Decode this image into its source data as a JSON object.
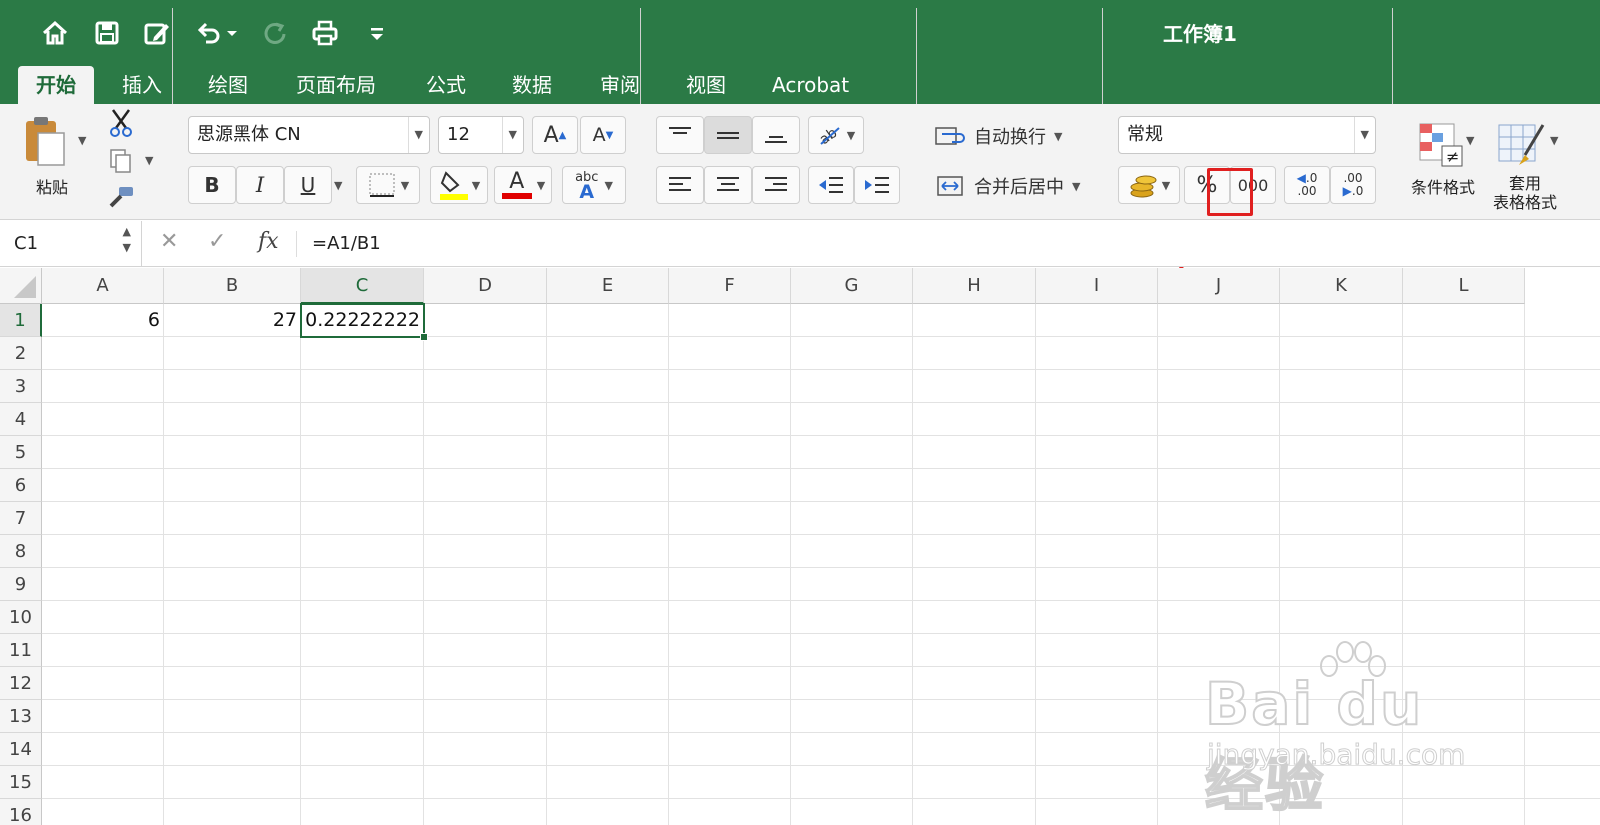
{
  "window": {
    "title": "工作簿1"
  },
  "quick_access": [
    {
      "icon": "home-icon"
    },
    {
      "icon": "save-icon"
    },
    {
      "icon": "edit-document-icon"
    },
    {
      "icon": "undo-icon"
    },
    {
      "icon": "redo-icon"
    },
    {
      "icon": "print-icon"
    },
    {
      "icon": "customize-icon"
    }
  ],
  "tabs": [
    "开始",
    "插入",
    "绘图",
    "页面布局",
    "公式",
    "数据",
    "审阅",
    "视图",
    "Acrobat"
  ],
  "ribbon": {
    "paste_label": "粘贴",
    "font_name": "思源黑体 CN",
    "font_size": "12",
    "bold": "B",
    "italic": "I",
    "underline": "U",
    "font_color_glyph": "A",
    "phonetic_glyph_top": "abc",
    "phonetic_glyph_bottom": "A",
    "grow_font": "A",
    "shrink_font": "A",
    "wrap_text_label": "自动换行",
    "merge_center_label": "合并后居中",
    "number_format": "常规",
    "percent_label": "%",
    "comma_label": "000",
    "increase_decimal_top": ".0",
    "increase_decimal_bottom": ".00",
    "decrease_decimal_top": ".00",
    "decrease_decimal_bottom": ".0",
    "conditional_format_label": "条件格式",
    "table_format_label_1": "套用",
    "table_format_label_2": "表格格式",
    "colors": {
      "highlight": "#ffff00",
      "font": "#e00000",
      "brand": "#2b7a46"
    }
  },
  "formula_bar": {
    "name_box": "C1",
    "fx": "fx",
    "formula": "=A1/B1"
  },
  "grid": {
    "columns": [
      "A",
      "B",
      "C",
      "D",
      "E",
      "F",
      "G",
      "H",
      "I",
      "J",
      "K",
      "L"
    ],
    "rows": [
      "1",
      "2",
      "3",
      "4",
      "5",
      "6",
      "7",
      "8",
      "9",
      "10",
      "11",
      "12",
      "13",
      "14",
      "15",
      "16"
    ],
    "cells": {
      "A1": "6",
      "B1": "27",
      "C1": "0.22222222"
    },
    "selected": "C1"
  },
  "watermark": {
    "main": "Bai du 经验",
    "sub": "jingyan.baidu.com"
  }
}
